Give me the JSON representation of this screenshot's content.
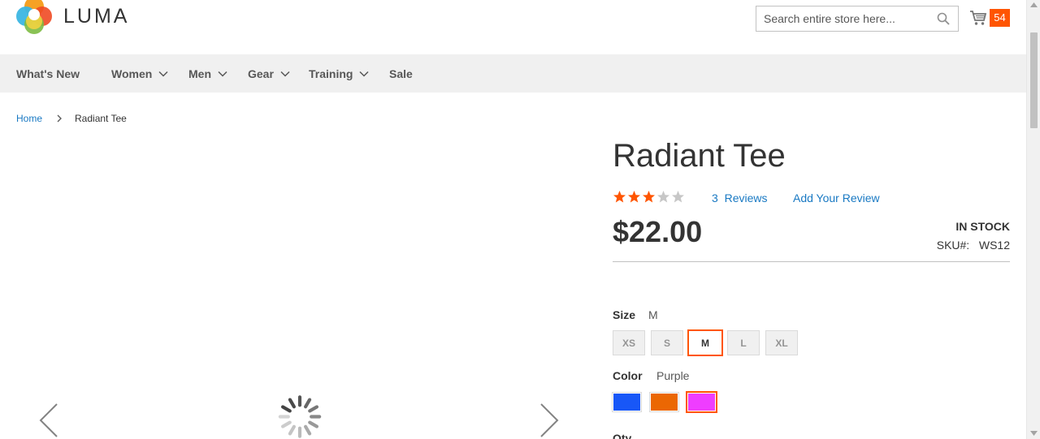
{
  "header": {
    "logo_text": "LUMA",
    "search_placeholder": "Search entire store here...",
    "cart_count": "54"
  },
  "nav": {
    "items": [
      {
        "label": "What's New",
        "has_dropdown": false
      },
      {
        "label": "Women",
        "has_dropdown": true
      },
      {
        "label": "Men",
        "has_dropdown": true
      },
      {
        "label": "Gear",
        "has_dropdown": true
      },
      {
        "label": "Training",
        "has_dropdown": true
      },
      {
        "label": "Sale",
        "has_dropdown": false
      }
    ]
  },
  "breadcrumb": {
    "home": "Home",
    "current": "Radiant Tee"
  },
  "product": {
    "title": "Radiant Tee",
    "rating_stars": 3,
    "rating_max": 5,
    "reviews_count": "3",
    "reviews_label": "Reviews",
    "add_review": "Add Your Review",
    "price": "$22.00",
    "stock": "IN STOCK",
    "sku_label": "SKU#:",
    "sku": "WS12",
    "size_label": "Size",
    "size_selected": "M",
    "sizes": [
      "XS",
      "S",
      "M",
      "L",
      "XL"
    ],
    "color_label": "Color",
    "color_selected": "Purple",
    "colors": [
      {
        "name": "Blue",
        "hex": "#1857f7"
      },
      {
        "name": "Orange",
        "hex": "#eb6703"
      },
      {
        "name": "Purple",
        "hex": "#ef3dff"
      }
    ],
    "qty_label": "Qty"
  },
  "colors": {
    "accent": "#ff5501",
    "link": "#1979c3",
    "nav_bg": "#f0f0f0"
  }
}
